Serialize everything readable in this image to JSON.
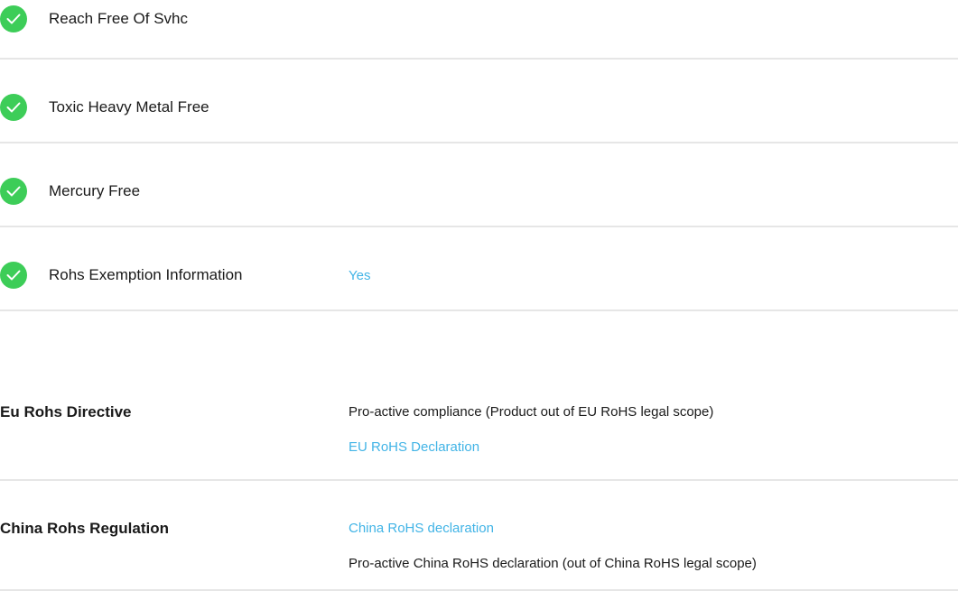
{
  "checks": [
    {
      "label": "Reach Free Of Svhc",
      "icon": "check-circle-icon"
    },
    {
      "label": "Toxic Heavy Metal Free",
      "icon": "check-circle-icon"
    },
    {
      "label": "Mercury Free",
      "icon": "check-circle-icon"
    },
    {
      "label": "Rohs Exemption Information",
      "value": "Yes",
      "icon": "check-circle-icon"
    }
  ],
  "regulations": {
    "eu": {
      "title": "Eu Rohs Directive",
      "text": "Pro-active compliance (Product out of EU RoHS legal scope)",
      "link": "EU RoHS Declaration"
    },
    "china": {
      "title": "China Rohs Regulation",
      "link": "China RoHS declaration",
      "text": "Pro-active China RoHS declaration (out of China RoHS legal scope)"
    }
  },
  "colors": {
    "check_green": "#3dcd58",
    "link_blue": "#42b4e6",
    "divider": "#e6e6e6"
  }
}
